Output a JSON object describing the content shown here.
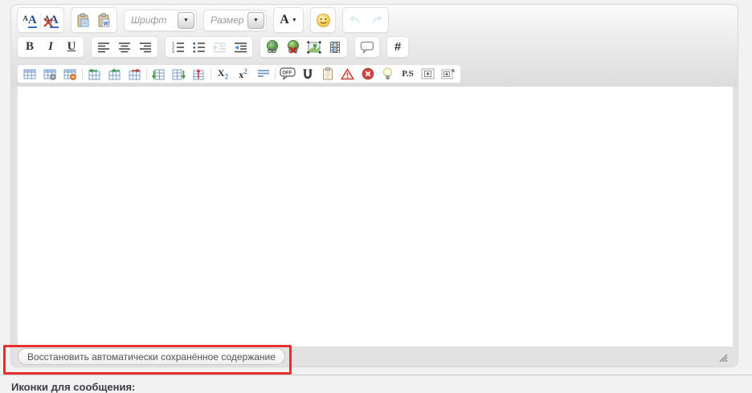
{
  "colors": {
    "annotation_red": "#e5302f",
    "toolbar_icon_blue": "#6e95c4",
    "page_background": "#f2f2f2",
    "toolbar_gradient_bottom": "#dcdcdc"
  },
  "toolbar": {
    "font_color_small_letter": "A",
    "font_color_letter": "A",
    "remove_format_letter": "A",
    "paste_word_letter": "W",
    "font_dropdown_label": "Шрифт",
    "size_dropdown_label": "Размер",
    "text_style_letter": "A",
    "dropdown_caret": "▼",
    "text_style_caret": "▼",
    "bold_label": "B",
    "italic_label": "I",
    "underline_label": "U",
    "hash_label": "#",
    "subscript_base": "X",
    "subscript_mark": "2",
    "superscript_base": "x",
    "superscript_mark": "2",
    "offtopic_label": "OFF",
    "ps_label": "P.S",
    "zoom_plus_letter": "A"
  },
  "editor": {
    "body_text": "",
    "restore_button_label": "Восстановить автоматически сохранённое содержание"
  },
  "page": {
    "icons_section_label": "Иконки для сообщения:"
  }
}
